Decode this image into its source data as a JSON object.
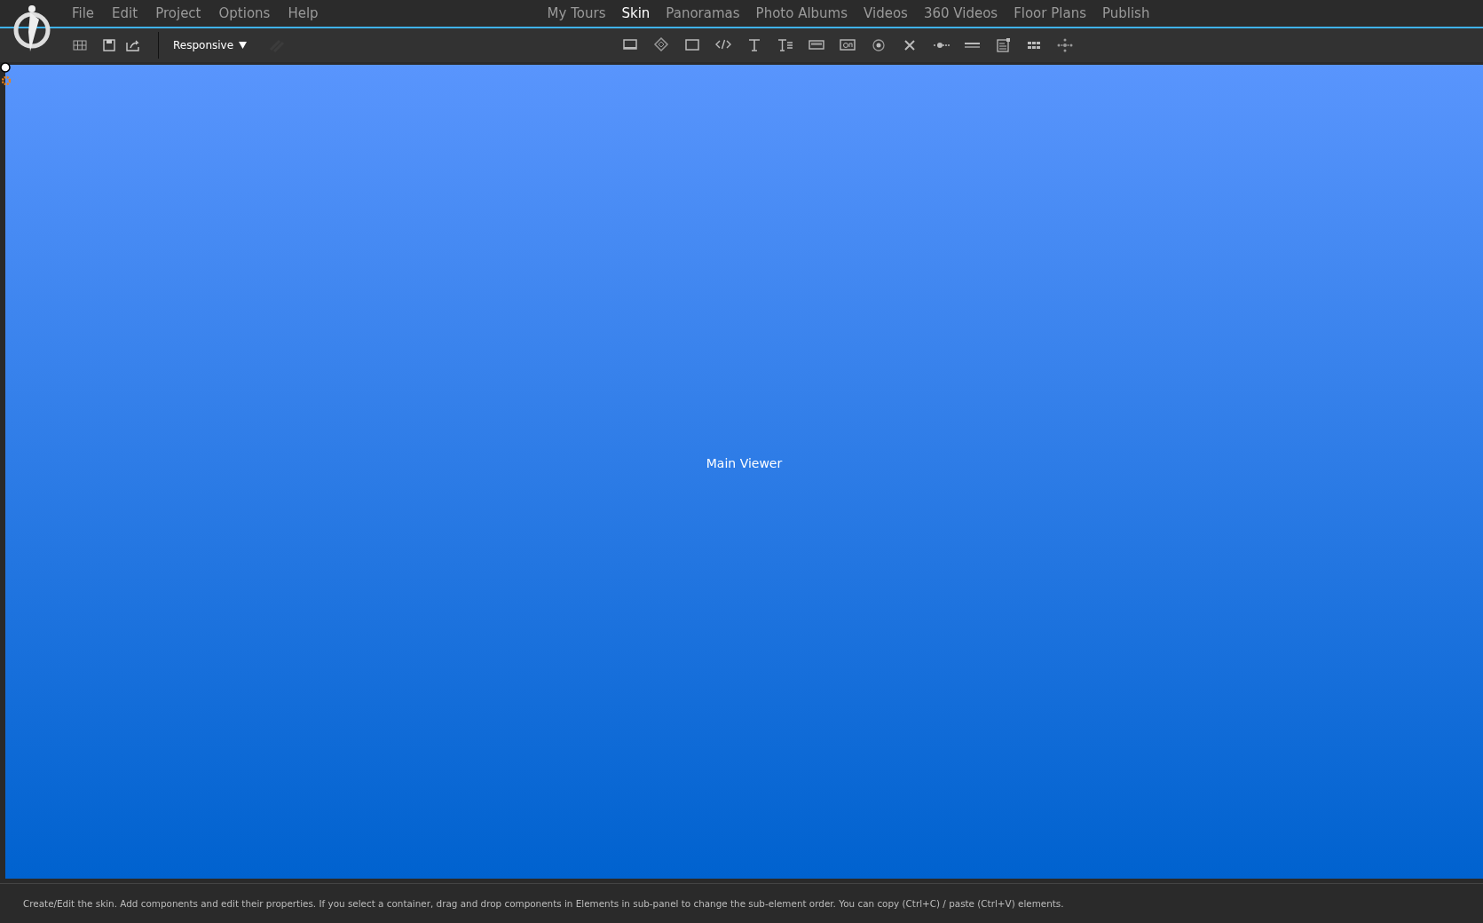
{
  "menu": [
    "File",
    "Edit",
    "Project",
    "Options",
    "Help"
  ],
  "tabs": [
    {
      "label": "My Tours",
      "selected": false
    },
    {
      "label": "Skin",
      "selected": true
    },
    {
      "label": "Panoramas",
      "selected": false
    },
    {
      "label": "Photo Albums",
      "selected": false
    },
    {
      "label": "Videos",
      "selected": false
    },
    {
      "label": "360 Videos",
      "selected": false
    },
    {
      "label": "Floor Plans",
      "selected": false
    },
    {
      "label": "Publish",
      "selected": false
    }
  ],
  "toolbar": {
    "mode_dropdown": "Responsive"
  },
  "canvas": {
    "element_label": "Main Viewer"
  },
  "status_bar": "Create/Edit the skin. Add components and edit their properties. If you select a container, drag and drop components in Elements in sub-panel to change the sub-element order. You can copy (Ctrl+C) / paste (Ctrl+V) elements."
}
